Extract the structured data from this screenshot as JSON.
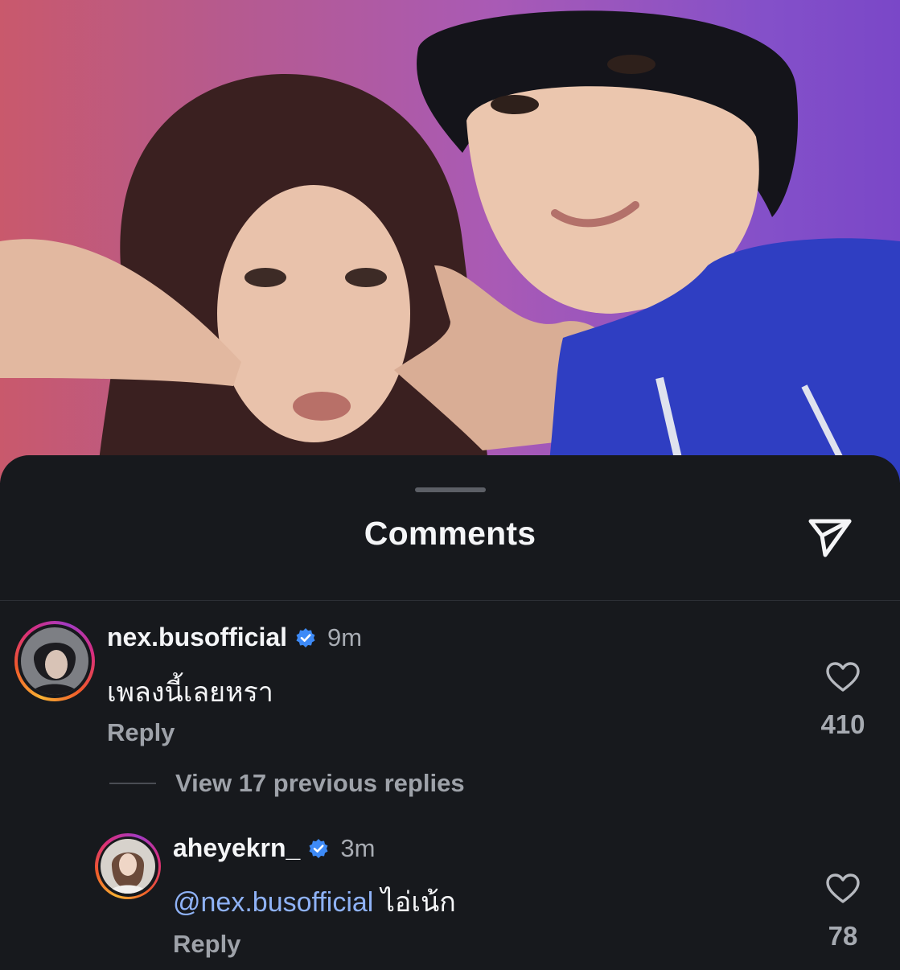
{
  "sheet": {
    "title": "Comments"
  },
  "comments": [
    {
      "username": "nex.busofficial",
      "verified": true,
      "time": "9m",
      "text": "เพลงนี้เลยหรา",
      "reply_label": "Reply",
      "likes": "410"
    }
  ],
  "thread": {
    "view_replies_label": "View 17 previous replies"
  },
  "replies": [
    {
      "username": "aheyekrn_",
      "verified": true,
      "time": "3m",
      "mention": "@nex.busofficial",
      "text": "ไอ่เน้ก",
      "reply_label": "Reply",
      "likes": "78"
    }
  ],
  "icons": {
    "share": "paper-plane-icon",
    "like": "heart-outline-icon",
    "verified": "verified-badge-icon"
  },
  "colors": {
    "background": "#17191d",
    "mention": "#8fb2f6",
    "verified": "#3d8af7"
  }
}
